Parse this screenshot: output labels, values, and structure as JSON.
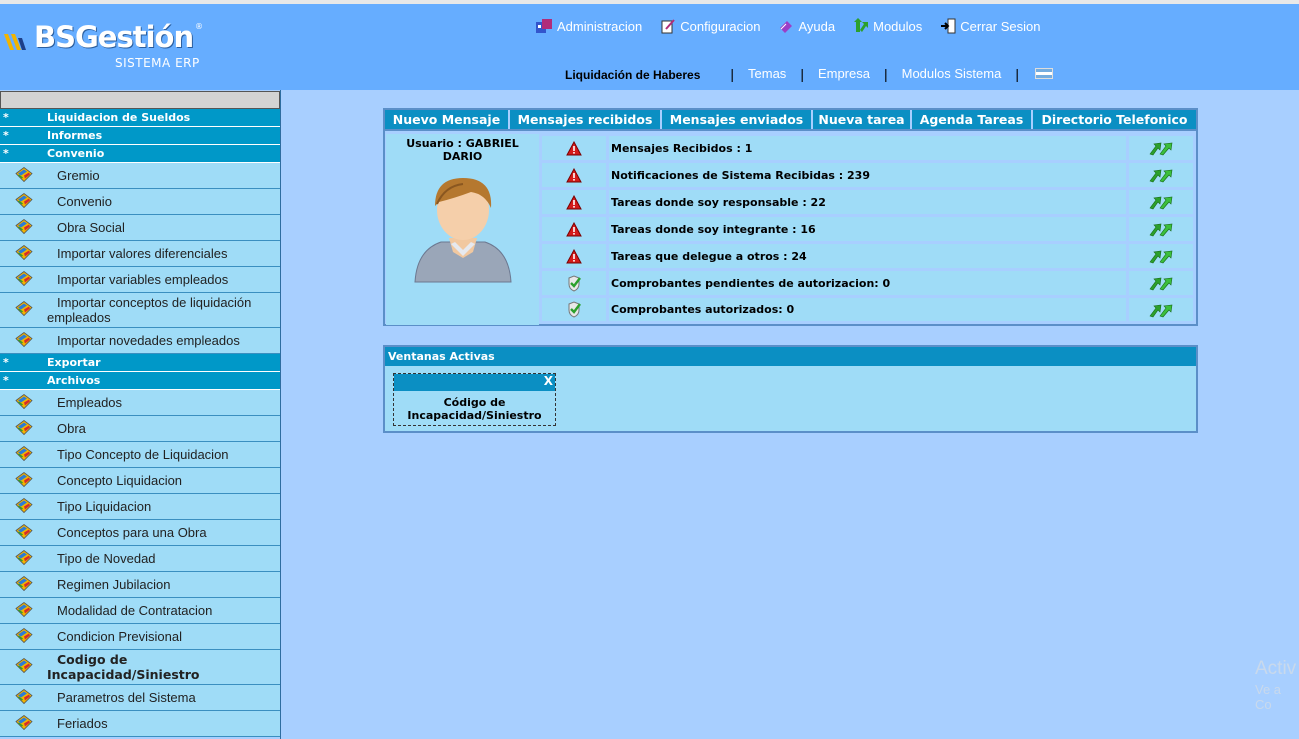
{
  "logo": {
    "main": "BSGestión",
    "sub": "SISTEMA ERP",
    "reg": "®"
  },
  "topnav": [
    {
      "label": "Administracion",
      "icon": "admin-icon"
    },
    {
      "label": "Configuracion",
      "icon": "config-icon"
    },
    {
      "label": "Ayuda",
      "icon": "help-icon"
    },
    {
      "label": "Modulos",
      "icon": "modules-icon"
    },
    {
      "label": "Cerrar Sesion",
      "icon": "logout-icon"
    }
  ],
  "subnav": {
    "current": "Liquidación de Haberes",
    "links": [
      "Temas",
      "Empresa",
      "Modulos Sistema"
    ],
    "separator": "|"
  },
  "sidebar": {
    "sections": [
      {
        "star": "*",
        "label": "Liquidacion de Sueldos"
      },
      {
        "star": "*",
        "label": "Informes"
      },
      {
        "star": "*",
        "label": "Convenio"
      },
      {
        "star": "*",
        "label": "Exportar"
      },
      {
        "star": "*",
        "label": "Archivos"
      }
    ],
    "convenio_items": [
      "Gremio",
      "Convenio",
      "Obra Social",
      "Importar valores diferenciales",
      "Importar variables empleados",
      "Importar conceptos de liquidación empleados",
      "Importar novedades empleados"
    ],
    "archivos_items": [
      "Empleados",
      "Obra",
      "Tipo Concepto de Liquidacion",
      "Concepto Liquidacion",
      "Tipo Liquidacion",
      "Conceptos para una Obra",
      "Tipo de Novedad",
      "Regimen Jubilacion",
      "Modalidad de Contratacion",
      "Condicion Previsional",
      "Codigo de Incapacidad/Siniestro",
      "Parametros del Sistema",
      "Feriados"
    ]
  },
  "tabs": [
    "Nuevo Mensaje",
    "Mensajes recibidos",
    "Mensajes enviados",
    "Nueva tarea",
    "Agenda Tareas",
    "Directorio Telefonico"
  ],
  "user": {
    "name": "Usuario : GABRIEL DARIO"
  },
  "rows": [
    {
      "status": "warning",
      "text": "Mensajes Recibidos : 1"
    },
    {
      "status": "warning",
      "text": "Notificaciones de Sistema Recibidas : 239"
    },
    {
      "status": "warning",
      "text": "Tareas donde soy responsable : 22"
    },
    {
      "status": "warning",
      "text": "Tareas donde soy integrante : 16"
    },
    {
      "status": "warning",
      "text": "Tareas que delegue a otros : 24"
    },
    {
      "status": "ok",
      "text": "Comprobantes pendientes de autorizacion: 0"
    },
    {
      "status": "ok",
      "text": "Comprobantes autorizados: 0"
    }
  ],
  "active_windows": {
    "title": "Ventanas Activas",
    "windows": [
      {
        "close": "X",
        "title": "Código de Incapacidad/Siniestro"
      }
    ]
  },
  "watermark": {
    "line1": "Activ",
    "line2": "Ve a Co"
  },
  "colors": {
    "header": "#66adff",
    "background": "#a8cfff",
    "section": "#0098c8",
    "item": "#9fdcf7",
    "tab": "#0b8fc3"
  }
}
